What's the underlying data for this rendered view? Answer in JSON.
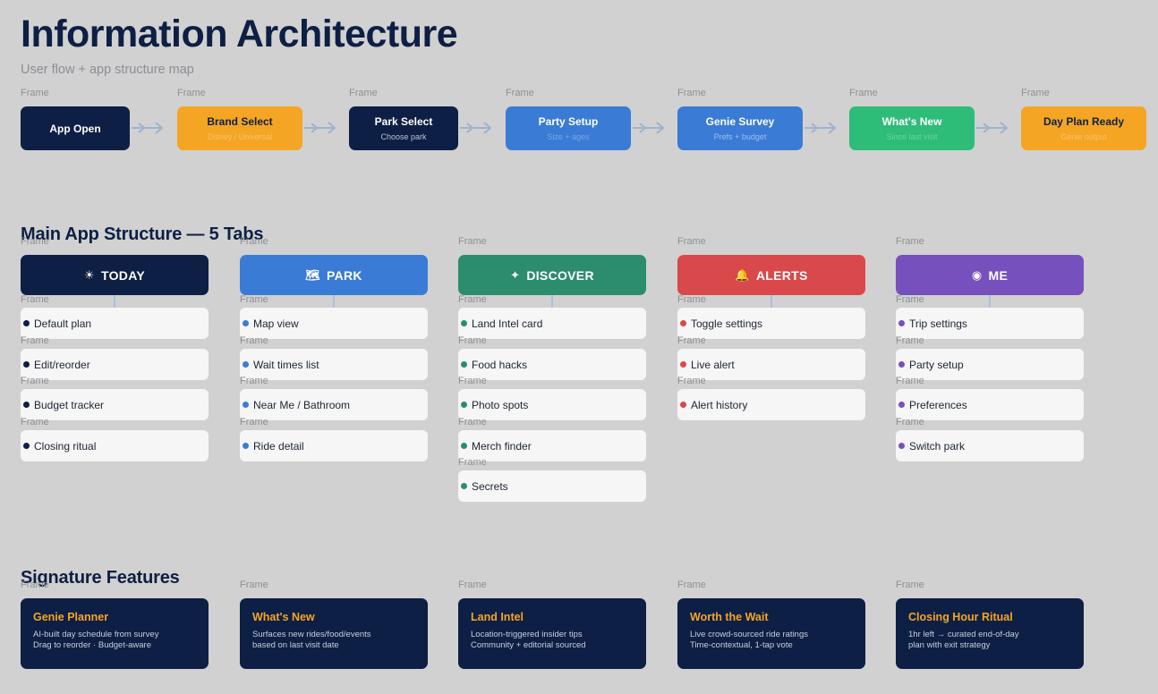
{
  "header": {
    "title": "Information Architecture",
    "subtitle": "User flow + app structure map"
  },
  "frame_label": "Frame",
  "flow": [
    {
      "title": "App Open",
      "sub": "",
      "color": "#0d1f44",
      "text": "#ffffff",
      "subcolor": "#c8d3e6"
    },
    {
      "title": "Brand Select",
      "sub": "Disney / Universal",
      "color": "#f5a524",
      "text": "#0d1f44",
      "subcolor": "#f7c56a"
    },
    {
      "title": "Park Select",
      "sub": "Choose park",
      "color": "#0d1f44",
      "text": "#ffffff",
      "subcolor": "#b9c4d8"
    },
    {
      "title": "Party Setup",
      "sub": "Size + ages",
      "color": "#3a7bd5",
      "text": "#ffffff",
      "subcolor": "#79a7e6"
    },
    {
      "title": "Genie Survey",
      "sub": "Prefs + budget",
      "color": "#3a7bd5",
      "text": "#ffffff",
      "subcolor": "#9ec0ef"
    },
    {
      "title": "What's New",
      "sub": "Since last visit",
      "color": "#2ebd78",
      "text": "#ffffff",
      "subcolor": "#6bd39f"
    },
    {
      "title": "Day Plan Ready",
      "sub": "Genie output",
      "color": "#f5a524",
      "text": "#0d1f44",
      "subcolor": "#f8c46b"
    }
  ],
  "structure": {
    "heading": "Main App Structure — 5 Tabs",
    "tabs": [
      {
        "label": "TODAY",
        "icon": "☀",
        "icon_name": "sun-icon",
        "color": "#0d1f44",
        "dot": "#0d1f44",
        "items": [
          "Default plan",
          "Edit/reorder",
          "Budget tracker",
          "Closing ritual"
        ]
      },
      {
        "label": "PARK",
        "icon": "🗺",
        "icon_name": "map-icon",
        "color": "#3a7bd5",
        "dot": "#3a7bd5",
        "items": [
          "Map view",
          "Wait times list",
          "Near Me / Bathroom",
          "Ride detail"
        ]
      },
      {
        "label": "DISCOVER",
        "icon": "✦",
        "icon_name": "sparkle-icon",
        "color": "#2b8c6e",
        "dot": "#2b8c6e",
        "items": [
          "Land Intel card",
          "Food hacks",
          "Photo spots",
          "Merch finder",
          "Secrets"
        ]
      },
      {
        "label": "ALERTS",
        "icon": "🔔",
        "icon_name": "bell-icon",
        "color": "#d9484b",
        "dot": "#d9484b",
        "items": [
          "Toggle settings",
          "Live alert",
          "Alert history"
        ]
      },
      {
        "label": "ME",
        "icon": "◉",
        "icon_name": "profile-icon",
        "color": "#7651bd",
        "dot": "#7651bd",
        "items": [
          "Trip settings",
          "Party setup",
          "Preferences",
          "Switch park"
        ]
      }
    ]
  },
  "features": {
    "heading": "Signature Features",
    "cards": [
      {
        "title": "Genie Planner",
        "desc": "AI-built day schedule from survey\nDrag to reorder · Budget-aware"
      },
      {
        "title": "What's New",
        "desc": "Surfaces new rides/food/events\nbased on last visit date"
      },
      {
        "title": "Land Intel",
        "desc": "Location-triggered insider tips\nCommunity + editorial sourced"
      },
      {
        "title": "Worth the Wait",
        "desc": "Live crowd-sourced ride ratings\nTime-contextual, 1-tap vote"
      },
      {
        "title": "Closing Hour Ritual",
        "desc": "1hr left → curated end-of-day\nplan with exit strategy"
      }
    ]
  }
}
